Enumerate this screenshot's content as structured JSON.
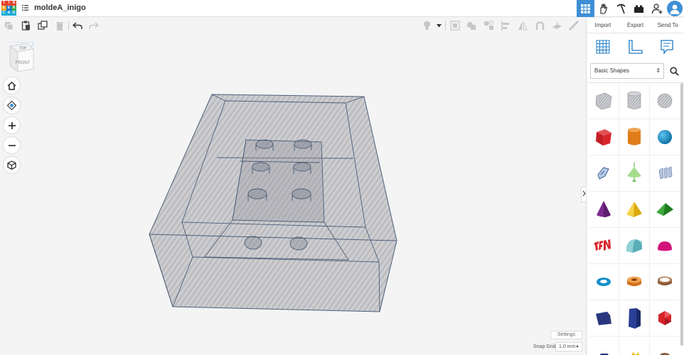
{
  "app": {
    "logo_letters": [
      "T",
      "I",
      "N",
      "K",
      "E",
      "R",
      "C",
      "A",
      "D"
    ],
    "document_title": "moldeA_inigo"
  },
  "right_panel": {
    "import_label": "Import",
    "export_label": "Export",
    "send_to_label": "Send To",
    "shape_category": "Basic Shapes"
  },
  "viewcube": {
    "top_label": "TOP",
    "front_label": "FRONT"
  },
  "footer": {
    "settings_label": "Settings",
    "snap_grid_label": "Snap Grid",
    "snap_grid_value": "1.0 mm"
  },
  "colors": {
    "accent": "#3d8fd6",
    "shape_red": "#d6252b",
    "shape_orange": "#e07c1a",
    "shape_blue": "#0a8ec7",
    "shape_purple": "#7b2a90",
    "shape_yellow": "#f2c21a",
    "shape_green": "#2e8b2e",
    "shape_teal": "#6bbfc6",
    "shape_magenta": "#d3137a",
    "shape_navy": "#27367d"
  },
  "shapes": [
    {
      "name": "box-hole-icon"
    },
    {
      "name": "cylinder-hole-icon"
    },
    {
      "name": "sphere-hole-icon"
    },
    {
      "name": "box-icon"
    },
    {
      "name": "cylinder-icon"
    },
    {
      "name": "sphere-icon"
    },
    {
      "name": "scribble-icon"
    },
    {
      "name": "shape-generator-icon"
    },
    {
      "name": "text-hole-icon"
    },
    {
      "name": "cone-icon"
    },
    {
      "name": "pyramid-icon"
    },
    {
      "name": "roof-icon"
    },
    {
      "name": "text-icon"
    },
    {
      "name": "round-roof-icon"
    },
    {
      "name": "half-sphere-icon"
    },
    {
      "name": "torus-icon"
    },
    {
      "name": "tube-icon"
    },
    {
      "name": "ring-icon"
    },
    {
      "name": "wedge-icon"
    },
    {
      "name": "hexagonal-prism-icon"
    },
    {
      "name": "polyhedron-icon"
    }
  ]
}
